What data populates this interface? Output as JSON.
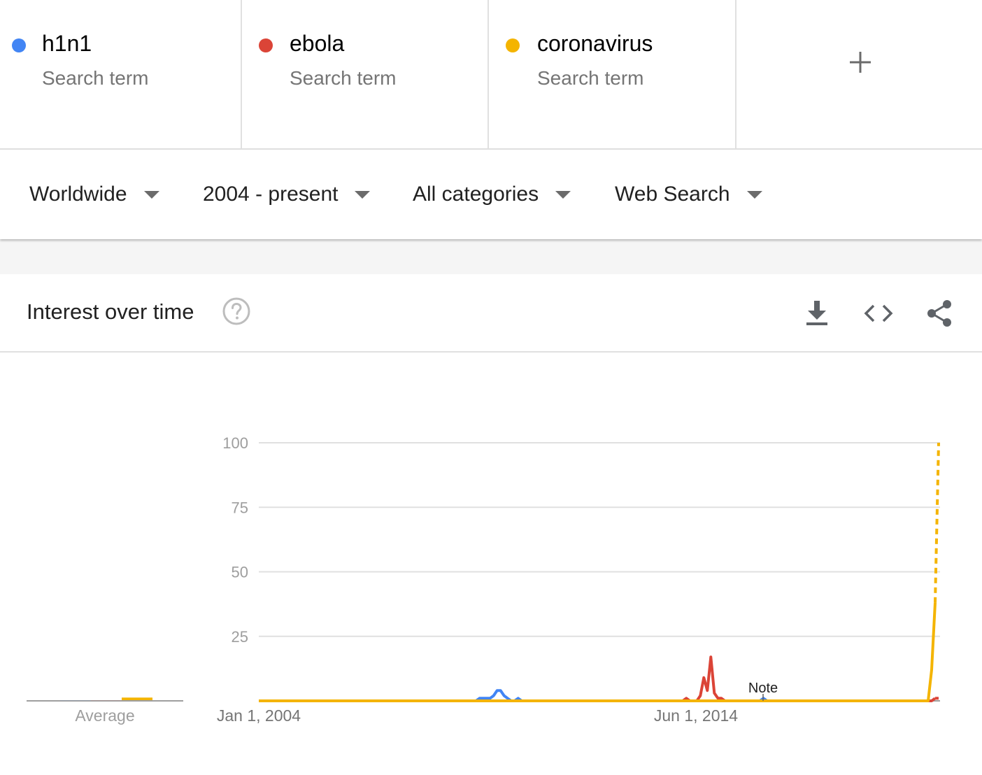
{
  "search_terms": [
    {
      "name": "h1n1",
      "subtitle": "Search term",
      "color": "#4285f4"
    },
    {
      "name": "ebola",
      "subtitle": "Search term",
      "color": "#db4437"
    },
    {
      "name": "coronavirus",
      "subtitle": "Search term",
      "color": "#f4b400"
    }
  ],
  "add_term_icon": "plus-icon",
  "filters": {
    "region": "Worldwide",
    "time_range": "2004 - present",
    "category": "All categories",
    "search_type": "Web Search"
  },
  "card": {
    "title": "Interest over time",
    "icons": [
      "help-icon",
      "download-icon",
      "embed-code-icon",
      "share-icon"
    ]
  },
  "chart_data": {
    "type": "line",
    "ylim": [
      0,
      100
    ],
    "y_ticks": [
      "100",
      "75",
      "50",
      "25"
    ],
    "x_ticks": [
      "Jan 1, 2004",
      "Jun 1, 2014"
    ],
    "average_label": "Average",
    "note_label": "Note",
    "x_range": [
      "2004-01",
      "2020-03"
    ],
    "series": [
      {
        "name": "h1n1",
        "color": "#4285f4",
        "points": [
          [
            "2004-01",
            0
          ],
          [
            "2009-03",
            0
          ],
          [
            "2009-04",
            1
          ],
          [
            "2009-05",
            1
          ],
          [
            "2009-06",
            1
          ],
          [
            "2009-07",
            1
          ],
          [
            "2009-08",
            2
          ],
          [
            "2009-09",
            4
          ],
          [
            "2009-10",
            4
          ],
          [
            "2009-11",
            2
          ],
          [
            "2009-12",
            1
          ],
          [
            "2010-01",
            0
          ],
          [
            "2010-02",
            0
          ],
          [
            "2010-03",
            1
          ],
          [
            "2010-04",
            0
          ],
          [
            "2015-12",
            0
          ],
          [
            "2016-01",
            1
          ],
          [
            "2016-02",
            0
          ],
          [
            "2020-03",
            0
          ]
        ]
      },
      {
        "name": "ebola",
        "color": "#db4437",
        "points": [
          [
            "2004-01",
            0
          ],
          [
            "2014-02",
            0
          ],
          [
            "2014-03",
            1
          ],
          [
            "2014-04",
            0
          ],
          [
            "2014-06",
            0
          ],
          [
            "2014-07",
            2
          ],
          [
            "2014-08",
            9
          ],
          [
            "2014-09",
            4
          ],
          [
            "2014-10",
            17
          ],
          [
            "2014-11",
            3
          ],
          [
            "2014-12",
            1
          ],
          [
            "2015-01",
            1
          ],
          [
            "2015-02",
            0
          ],
          [
            "2020-01",
            0
          ],
          [
            "2020-02",
            1
          ],
          [
            "2020-03",
            1
          ]
        ]
      },
      {
        "name": "coronavirus",
        "color": "#f4b400",
        "points": [
          [
            "2004-01",
            0
          ],
          [
            "2019-12",
            0
          ],
          [
            "2020-01",
            12
          ],
          [
            "2020-02",
            38
          ],
          [
            "2020-03",
            100
          ]
        ]
      }
    ],
    "partial_from": "2020-02",
    "averages": [
      {
        "name": "h1n1",
        "value": 0
      },
      {
        "name": "ebola",
        "value": 0
      },
      {
        "name": "coronavirus",
        "value": 1
      }
    ]
  }
}
